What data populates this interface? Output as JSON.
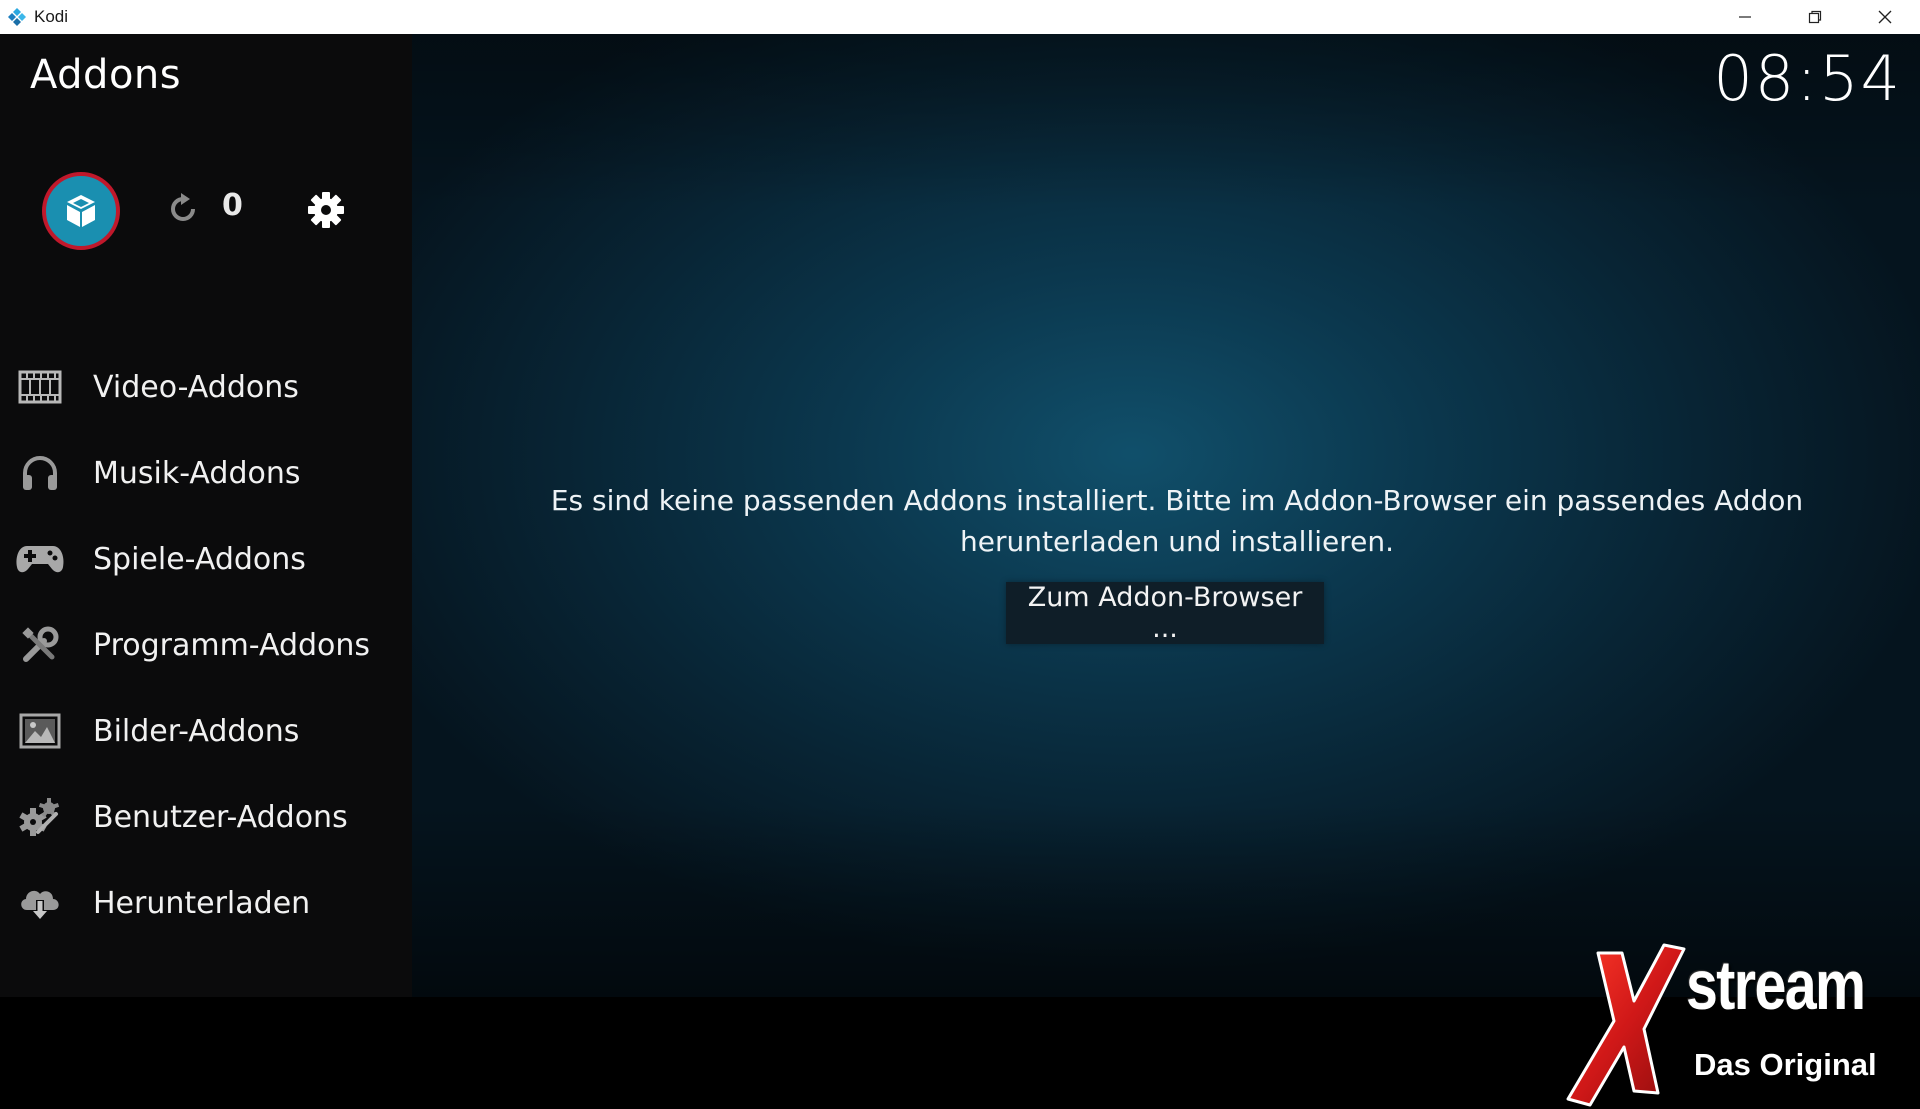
{
  "window": {
    "title": "Kodi",
    "minimize_icon": "minimize-icon",
    "restore_icon": "restore-icon",
    "close_icon": "close-icon"
  },
  "header": {
    "title": "Addons",
    "clock": "08:54"
  },
  "toolbar": {
    "addon_browser_icon": "open-box-icon",
    "update_icon": "refresh-icon",
    "update_count": "0",
    "settings_icon": "gear-icon"
  },
  "sidebar": {
    "items": [
      {
        "label": "Video-Addons",
        "icon": "film-strip-icon"
      },
      {
        "label": "Musik-Addons",
        "icon": "headphones-icon"
      },
      {
        "label": "Spiele-Addons",
        "icon": "gamepad-icon"
      },
      {
        "label": "Programm-Addons",
        "icon": "tools-icon"
      },
      {
        "label": "Bilder-Addons",
        "icon": "picture-icon"
      },
      {
        "label": "Benutzer-Addons",
        "icon": "user-gears-icon"
      },
      {
        "label": "Herunterladen",
        "icon": "cloud-download-icon"
      }
    ]
  },
  "main": {
    "message_line1": "Es sind keine passenden Addons installiert. Bitte im Addon-Browser ein passendes Addon",
    "message_line2": "herunterladen und installieren.",
    "button_label": "Zum Addon-Browser ..."
  },
  "watermark": {
    "letter": "X",
    "word": "stream",
    "subtitle": "Das Original"
  },
  "colors": {
    "accent": "#1a8fb0",
    "focus_ring": "#c0182b",
    "logo_red": "#d01818"
  }
}
